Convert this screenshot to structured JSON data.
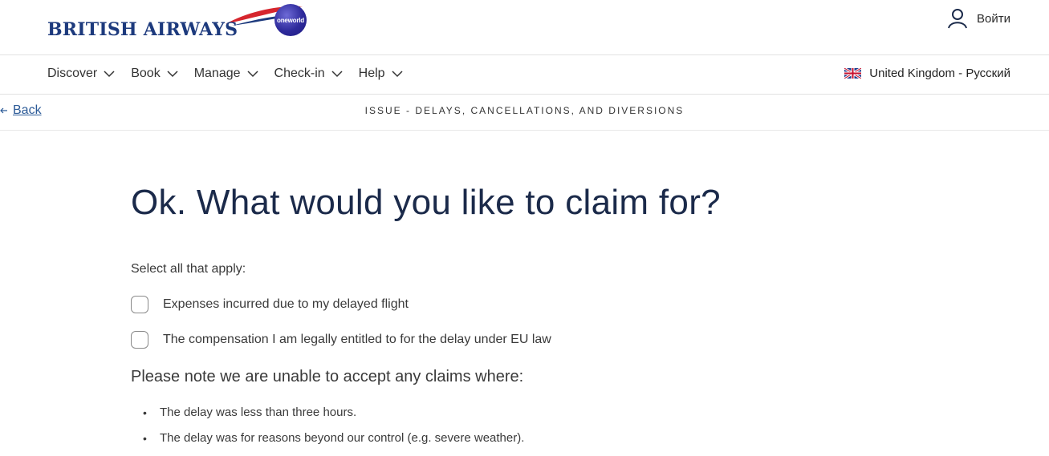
{
  "header": {
    "brand": "BRITISH AIRWAYS",
    "alliance": "oneworld",
    "login_label": "Войти",
    "colors": {
      "brand_blue": "#1d3a7d",
      "swoosh_red": "#d6262e",
      "link_blue": "#2b5a97"
    }
  },
  "nav": {
    "items": [
      {
        "label": "Discover"
      },
      {
        "label": "Book"
      },
      {
        "label": "Manage"
      },
      {
        "label": "Check-in"
      },
      {
        "label": "Help"
      }
    ],
    "locale": "United Kingdom - Русский"
  },
  "subbar": {
    "back_label": "Back",
    "issue_title": "ISSUE - DELAYS, CANCELLATIONS, AND DIVERSIONS"
  },
  "main": {
    "title": "Ok. What would you like to claim for?",
    "instruction": "Select all that apply:",
    "options": [
      {
        "label": "Expenses incurred due to my delayed flight",
        "checked": false
      },
      {
        "label": "The compensation I am legally entitled to for the delay under EU law",
        "checked": false
      }
    ],
    "note": "Please note we are unable to accept any claims where:",
    "bullets": [
      "The delay was less than three hours.",
      "The delay was for reasons beyond our control (e.g. severe weather)."
    ]
  }
}
